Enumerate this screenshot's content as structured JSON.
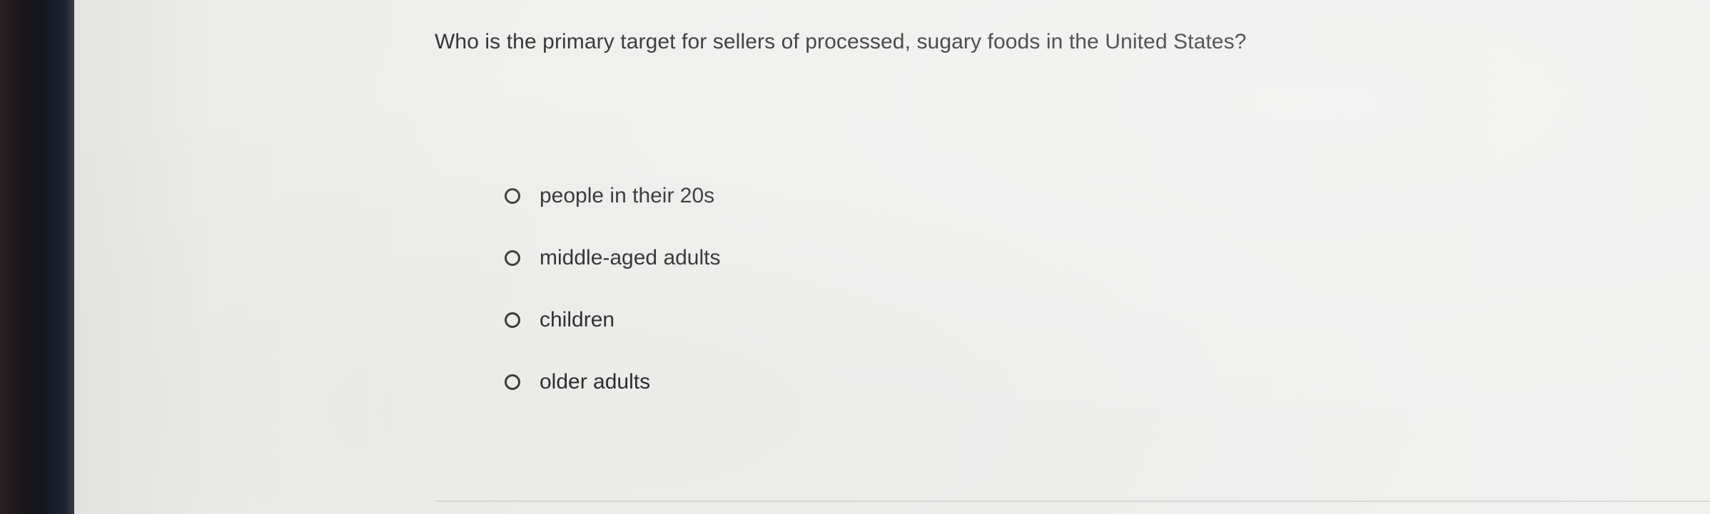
{
  "question": {
    "text": "Who is the primary target for sellers of processed, sugary foods in the United States?"
  },
  "options": [
    {
      "label": "people in their 20s",
      "selected": false
    },
    {
      "label": "middle-aged adults",
      "selected": false
    },
    {
      "label": "children",
      "selected": false
    },
    {
      "label": "older adults",
      "selected": false
    }
  ],
  "colors": {
    "background": "#efefed",
    "text": "#2c2c2c",
    "radio_border": "#3b3b3b"
  }
}
